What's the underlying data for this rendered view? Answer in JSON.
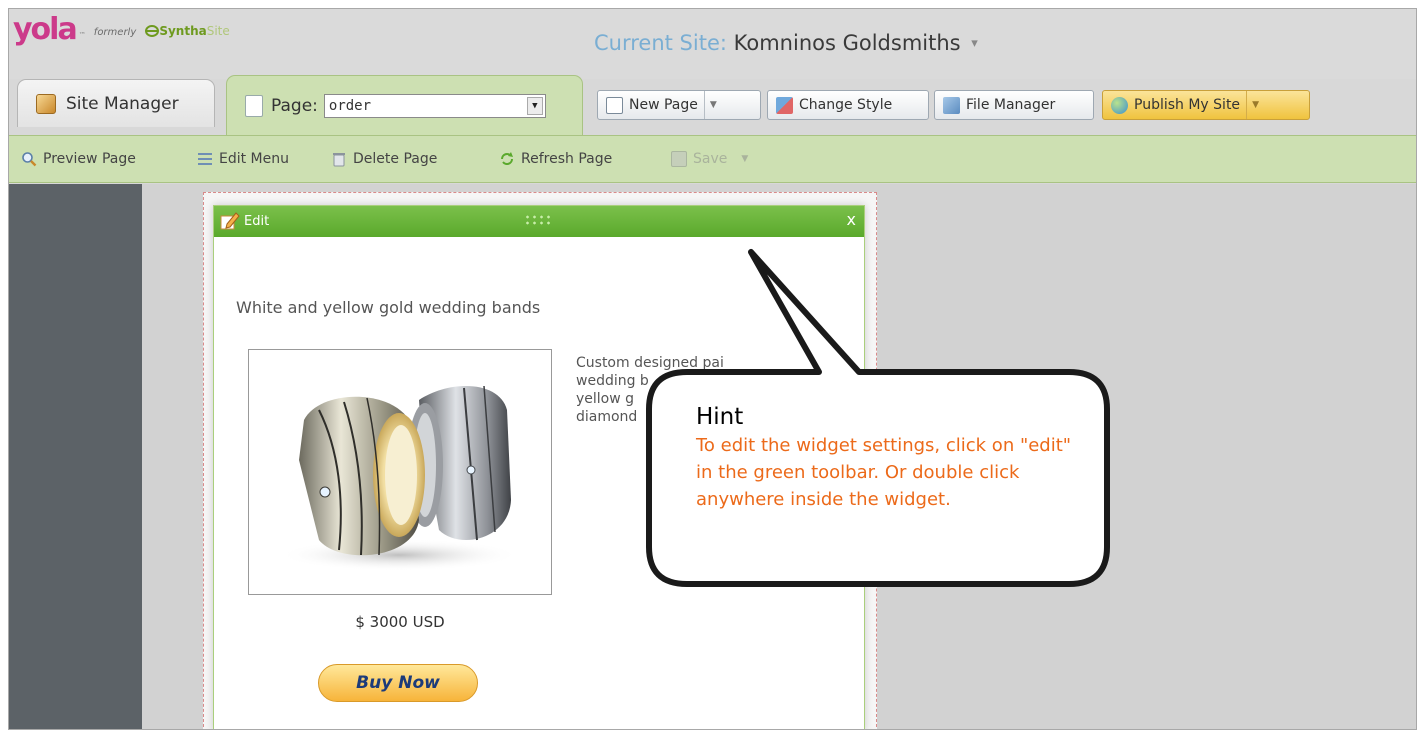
{
  "header": {
    "logo": {
      "name": "yola",
      "tm": "™",
      "formerly": "formerly",
      "synth1": "Syntha",
      "synth2": "Site"
    },
    "current_site_label": "Current Site:",
    "current_site_name": "Komninos Goldsmiths",
    "caret": "▾"
  },
  "tabs": {
    "site_manager": "Site Manager",
    "page_label": "Page:",
    "page_value": "order"
  },
  "top_buttons": {
    "new_page": "New Page",
    "change_style": "Change Style",
    "file_manager": "File Manager",
    "publish": "Publish My Site"
  },
  "page_toolbar": {
    "preview": "Preview Page",
    "edit_menu": "Edit Menu",
    "delete": "Delete Page",
    "refresh": "Refresh Page",
    "save": "Save"
  },
  "widget": {
    "edit_label": "Edit",
    "close": "x",
    "title": "White and yellow gold wedding bands",
    "description_lines": [
      "Custom designed pai",
      "wedding b",
      "yellow g",
      "diamond"
    ],
    "price": "$ 3000 USD",
    "buy_button": "Buy Now"
  },
  "hint": {
    "title": "Hint",
    "body": "To edit the widget settings, click on \"edit\" in the green toolbar. Or double click anywhere inside the widget."
  },
  "colors": {
    "accent_green": "#5aa92c",
    "toolbar_green": "#cde0b2",
    "hint_orange": "#ec6a1a",
    "brand_pink": "#cc3a8a"
  }
}
